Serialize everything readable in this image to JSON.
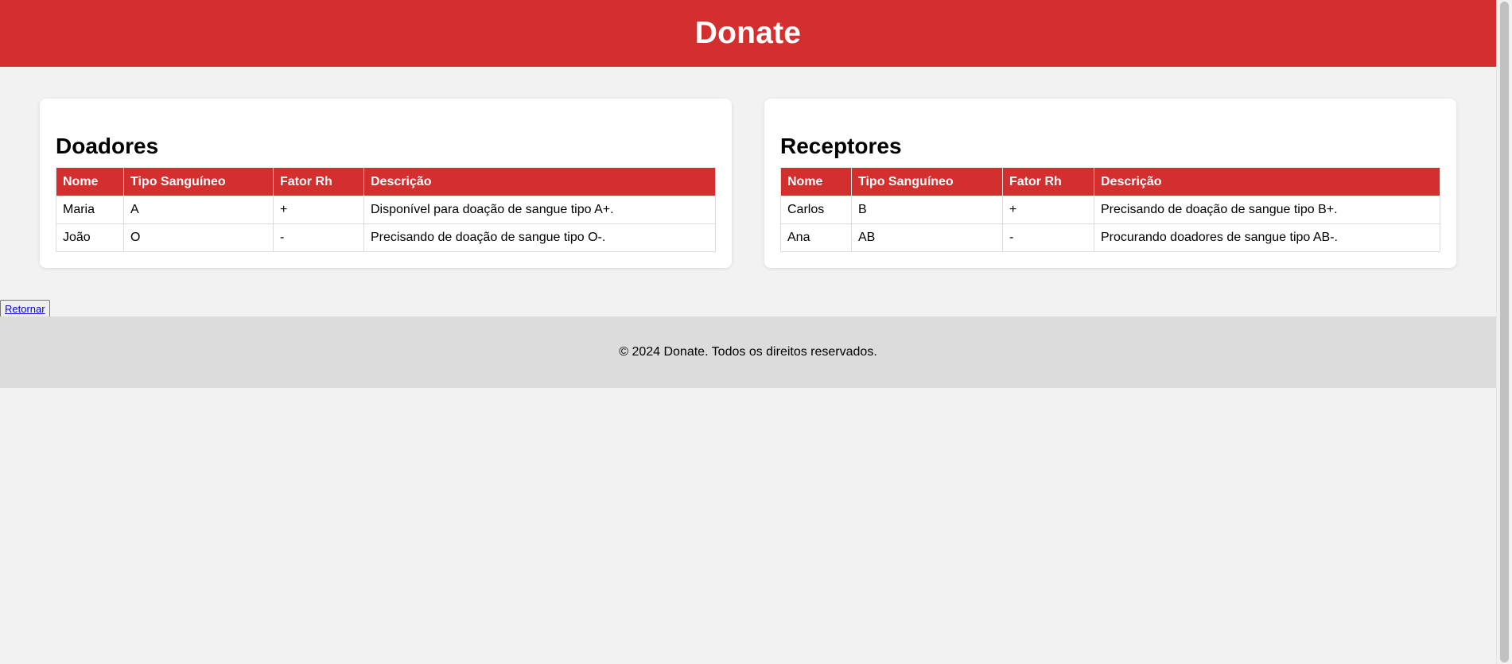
{
  "header": {
    "title": "Donate"
  },
  "donors": {
    "title": "Doadores",
    "columns": [
      "Nome",
      "Tipo Sanguíneo",
      "Fator Rh",
      "Descrição"
    ],
    "rows": [
      [
        "Maria",
        "A",
        "+",
        "Disponível para doação de sangue tipo A+."
      ],
      [
        "João",
        "O",
        "-",
        "Precisando de doação de sangue tipo O-."
      ]
    ]
  },
  "receivers": {
    "title": "Receptores",
    "columns": [
      "Nome",
      "Tipo Sanguíneo",
      "Fator Rh",
      "Descrição"
    ],
    "rows": [
      [
        "Carlos",
        "B",
        "+",
        "Precisando de doação de sangue tipo B+."
      ],
      [
        "Ana",
        "AB",
        "-",
        "Procurando doadores de sangue tipo AB-."
      ]
    ]
  },
  "actions": {
    "return_label": "Retornar"
  },
  "footer": {
    "text": "© 2024 Donate. Todos os direitos reservados."
  },
  "colors": {
    "brand_red": "#d32f2f",
    "background": "#f2f2f2",
    "footer_bg": "#dcdcdc"
  }
}
